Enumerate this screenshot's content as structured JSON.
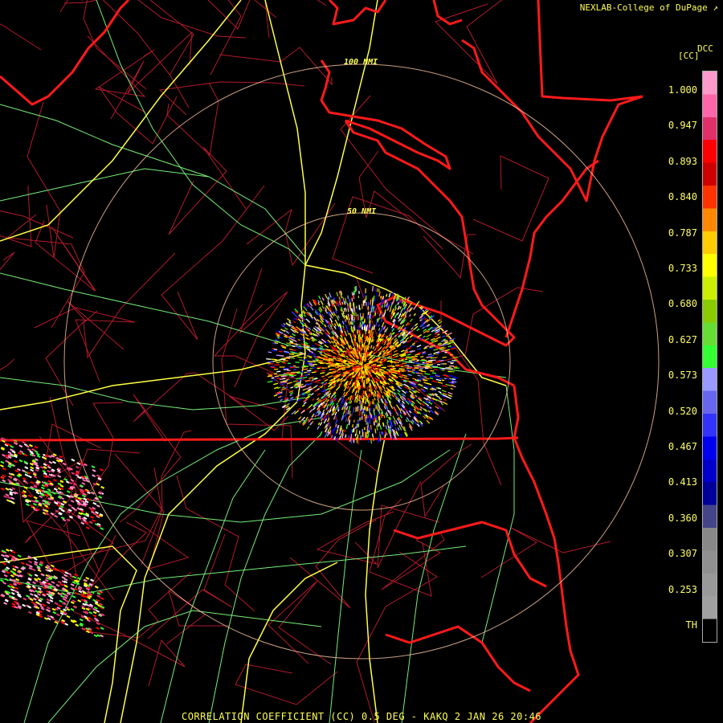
{
  "credit": "NEXLAB-College of DuPage",
  "credit_icon": "external-link-icon",
  "colorbar": {
    "code": "DCC",
    "unit": "[CC]",
    "ticks": [
      "1.000",
      "0.947",
      "0.893",
      "0.840",
      "0.787",
      "0.733",
      "0.680",
      "0.627",
      "0.573",
      "0.520",
      "0.467",
      "0.413",
      "0.360",
      "0.307",
      "0.253",
      "TH"
    ],
    "colors": [
      "#ff99cc",
      "#ff66aa",
      "#e0306a",
      "#ff0000",
      "#cc0000",
      "#ff3300",
      "#ff8800",
      "#ffcc00",
      "#ffff00",
      "#ccee00",
      "#88cc00",
      "#66dd33",
      "#33ff33",
      "#9999ff",
      "#6666ee",
      "#3333ff",
      "#0000ee",
      "#0000cc",
      "#000099",
      "#444488",
      "#888888",
      "#909090",
      "#999999",
      "#a0a0a0",
      "#000000"
    ]
  },
  "range_rings": [
    "100 NMI",
    "50 NMI"
  ],
  "footer": "CORRELATION COEFFICIENT (CC) 0.5 DEG - KAKQ 2 JAN 26 20:46",
  "colors": {
    "state_border": "#ff1a1a",
    "county": "#b21a2a",
    "highway": "#ffff44",
    "road": "#77ee77",
    "ring": "#ffc8a0",
    "text": "#ffff55"
  }
}
